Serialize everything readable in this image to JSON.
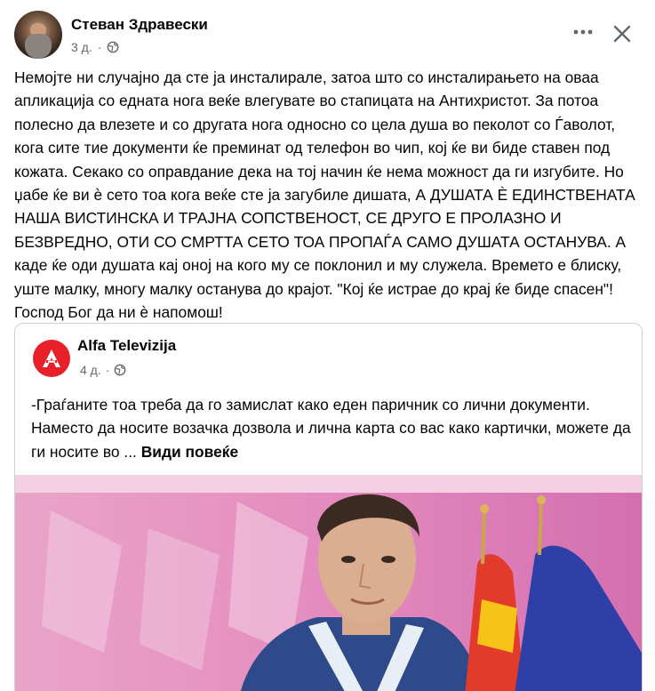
{
  "post": {
    "author": "Стеван Здравески",
    "time": "3 д.",
    "separator": "·",
    "text": "Немојте ни случајно да сте ја инсталирале, затоа што со инсталирањето на оваа апликација со едната нога веќе влегувате во стапицата на Антихристот. За потоа полесно да влезете и со другата нога односно со цела душа во пеколот со Ѓаволот, кога сите тие документи ќе преминат од телефон во чип, кој ќе ви биде ставен под кожата. Секако со оправдание дека на тој начин ќе нема можност да ги изгубите. Но џабе ќе ви ѐ сето тоа кога веќе сте ја загубиле дишата, А ДУШАТА Ѐ ЕДИНСТВЕНАТА НАША ВИСТИНСКА И ТРАЈНА СОПСТВЕНОСТ, СЕ ДРУГО Е ПРОЛАЗНО И БЕЗВРЕДНО, ОТИ СО СМРТТА СЕТО ТОА ПРОПАЃА САМО ДУШАТА ОСТАНУВА. А каде ќе оди душата кај оној на кого му се поклонил и му служела. Времето е блиску, уште малку, многу малку останува до крајот. \"Кој ќе истрае до крај ќе биде спасен\"! Господ Бог да ни ѐ напомош!"
  },
  "icons": {
    "more": "more-dots-icon",
    "close": "close-icon",
    "audience": "globe-icon",
    "page_logo": "alfa-logo"
  },
  "shared": {
    "page_name": "Alfa Televizija",
    "time": "4 д.",
    "separator": "·",
    "text": "-Граѓаните тоа треба да го замислат како еден паричник со лични документи. Наместо да носите возачка дозвола и лична карта со вас како картички, можете да ги носите во ...",
    "see_more": "Види повеќе"
  },
  "colors": {
    "brand_red": "#e8202a",
    "secondary_text": "#65676b",
    "border": "#ced0d4"
  }
}
